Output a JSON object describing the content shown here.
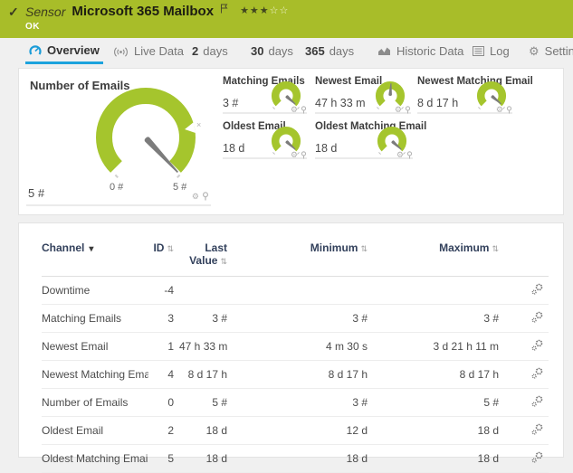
{
  "header": {
    "type_label": "Sensor",
    "title": "Microsoft 365 Mailbox",
    "status": "OK",
    "stars_filled": "★★★",
    "stars_empty": "☆☆"
  },
  "icons": {
    "check": "✓",
    "gear": "⚙",
    "sort": "⇅",
    "channel_sort": "▾",
    "peak_marker": "×"
  },
  "tabs": [
    {
      "label": "Overview"
    },
    {
      "label": "Live Data"
    },
    {
      "num": "2",
      "label": "days"
    },
    {
      "num": "30",
      "label": "days"
    },
    {
      "num": "365",
      "label": "days"
    },
    {
      "label": "Historic Data"
    },
    {
      "label": "Log"
    },
    {
      "label": "Settings"
    }
  ],
  "gauges": {
    "main": {
      "title": "Number of Emails",
      "value": "5 #",
      "scale_min": "0 #",
      "scale_max": "5 #",
      "needle_angle": 47
    },
    "small": [
      {
        "title": "Matching Emails",
        "value": "3 #",
        "needle_angle": 42
      },
      {
        "title": "Newest Email",
        "value": "47 h 33 m",
        "needle_angle": -86
      },
      {
        "title": "Newest Matching Email",
        "value": "8 d 17 h",
        "needle_angle": 40
      },
      {
        "title": "Oldest Email",
        "value": "18 d",
        "needle_angle": 42
      },
      {
        "title": "Oldest Matching Email",
        "value": "18 d",
        "needle_angle": 42
      }
    ]
  },
  "table": {
    "columns": [
      "Channel",
      "ID",
      "Last Value",
      "Minimum",
      "Maximum"
    ],
    "rows": [
      {
        "channel": "Downtime",
        "id": "-4",
        "last": "",
        "min": "",
        "max": ""
      },
      {
        "channel": "Matching Emails",
        "id": "3",
        "last": "3 #",
        "min": "3 #",
        "max": "3 #"
      },
      {
        "channel": "Newest Email",
        "id": "1",
        "last": "47 h 33 m",
        "min": "4 m 30 s",
        "max": "3 d 21 h 11 m"
      },
      {
        "channel": "Newest Matching Email",
        "id": "4",
        "last": "8 d 17 h",
        "min": "8 d 17 h",
        "max": "8 d 17 h"
      },
      {
        "channel": "Number of Emails",
        "id": "0",
        "last": "5 #",
        "min": "3 #",
        "max": "5 #"
      },
      {
        "channel": "Oldest Email",
        "id": "2",
        "last": "18 d",
        "min": "12 d",
        "max": "18 d"
      },
      {
        "channel": "Oldest Matching Email",
        "id": "5",
        "last": "18 d",
        "min": "18 d",
        "max": "18 d"
      }
    ]
  },
  "colors": {
    "status_ok_green": "#a8bd29",
    "gauge_green": "#a5c52d",
    "accent_blue": "#1ca3dd",
    "table_header_navy": "#33415c"
  }
}
